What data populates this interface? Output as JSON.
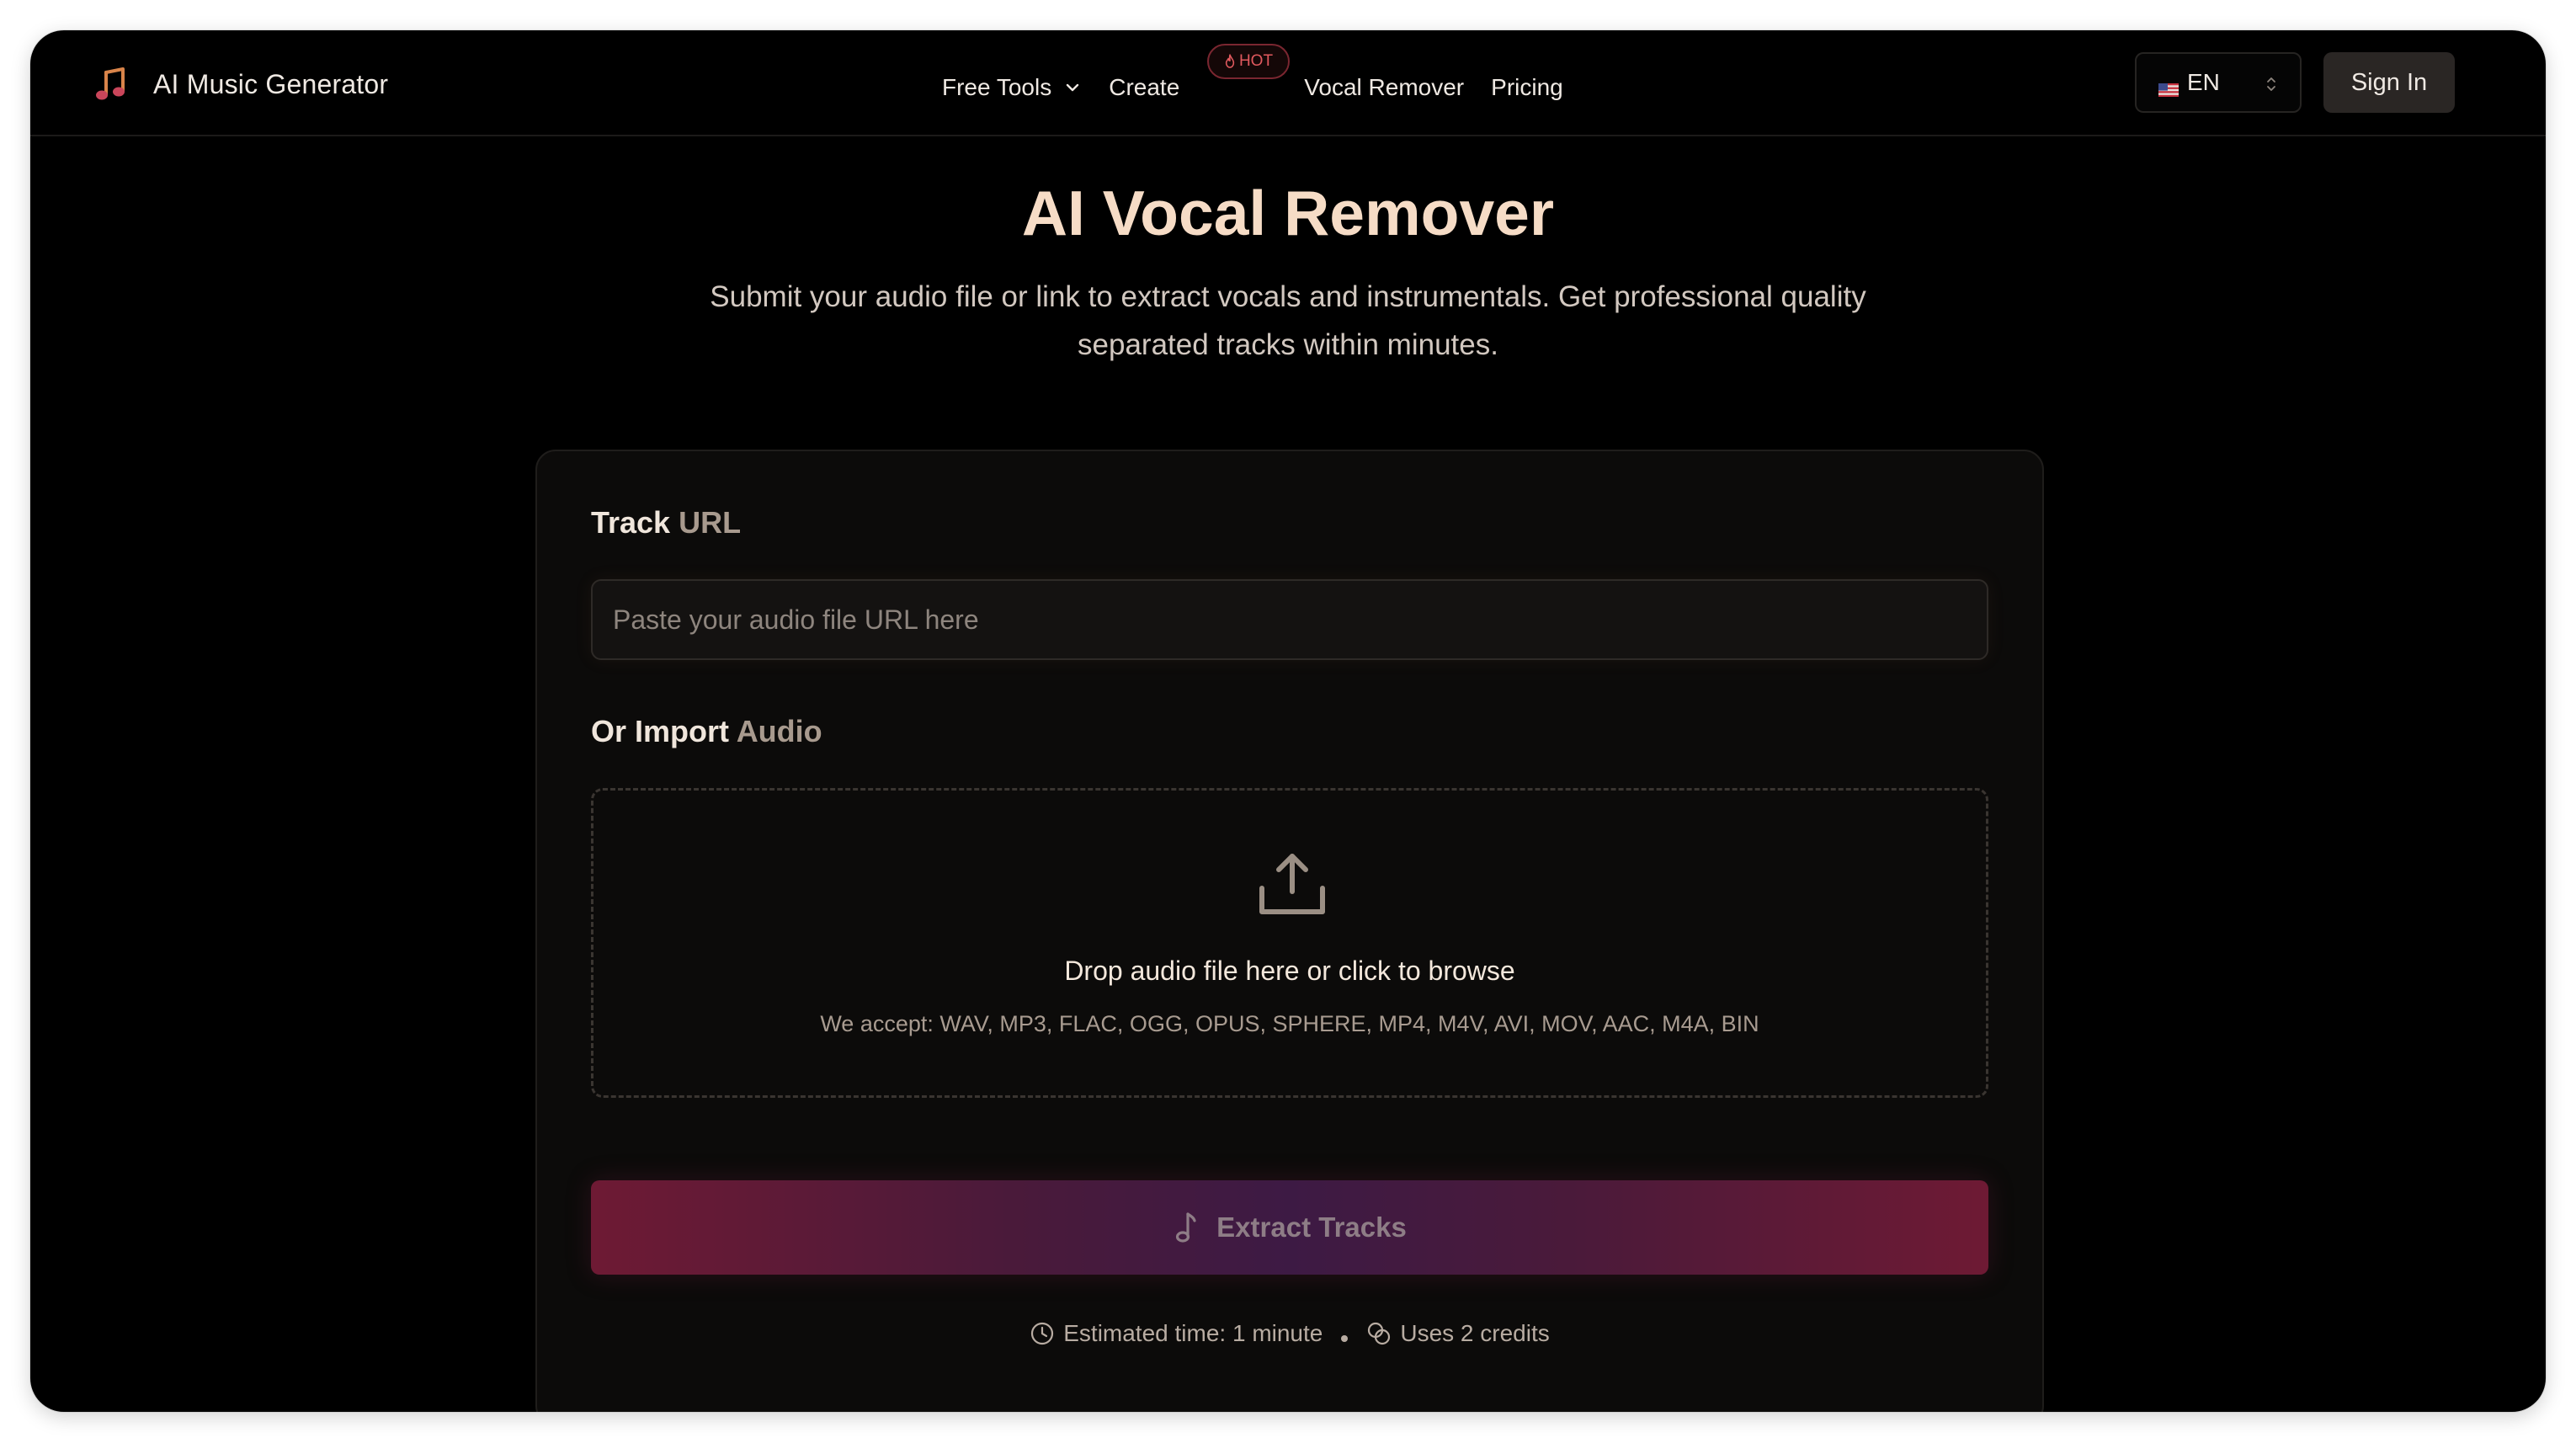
{
  "app": {
    "brand_name": "AI Music Generator",
    "brand_icon": "music-note-icon"
  },
  "nav": {
    "links": [
      {
        "label": "Free Tools",
        "has_dropdown": true
      },
      {
        "label": "Create",
        "badge": "HOT"
      },
      {
        "label": "Vocal Remover"
      },
      {
        "label": "Pricing"
      }
    ],
    "language": {
      "code": "EN",
      "flag": "us-flag-icon"
    },
    "sign_in_label": "Sign In"
  },
  "hero": {
    "title": "AI Vocal Remover",
    "subtitle_line1": "Submit your audio file or link to extract vocals and instrumentals. Get professional quality",
    "subtitle_line2": "separated tracks within minutes."
  },
  "form": {
    "track_url": {
      "label_strong": "Track",
      "label_muted": "URL",
      "placeholder": "Paste your audio file URL here",
      "value": ""
    },
    "import_audio": {
      "label_strong": "Or Import",
      "label_muted": "Audio",
      "drop_title": "Drop audio file here or click to browse",
      "accepted_formats": "We accept: WAV, MP3, FLAC, OGG, OPUS, SPHERE, MP4, M4V, AVI, MOV, AAC, M4A, BIN"
    },
    "submit_label": "Extract Tracks",
    "estimated_time": "Estimated time: 1 minute",
    "credits": "Uses 2 credits"
  },
  "colors": {
    "accent_title": "#f6dcc6",
    "hot_badge": "#e0595e",
    "button_gradient_start": "#6e1a34",
    "button_gradient_mid": "#3d1a44",
    "background": "#000000"
  }
}
